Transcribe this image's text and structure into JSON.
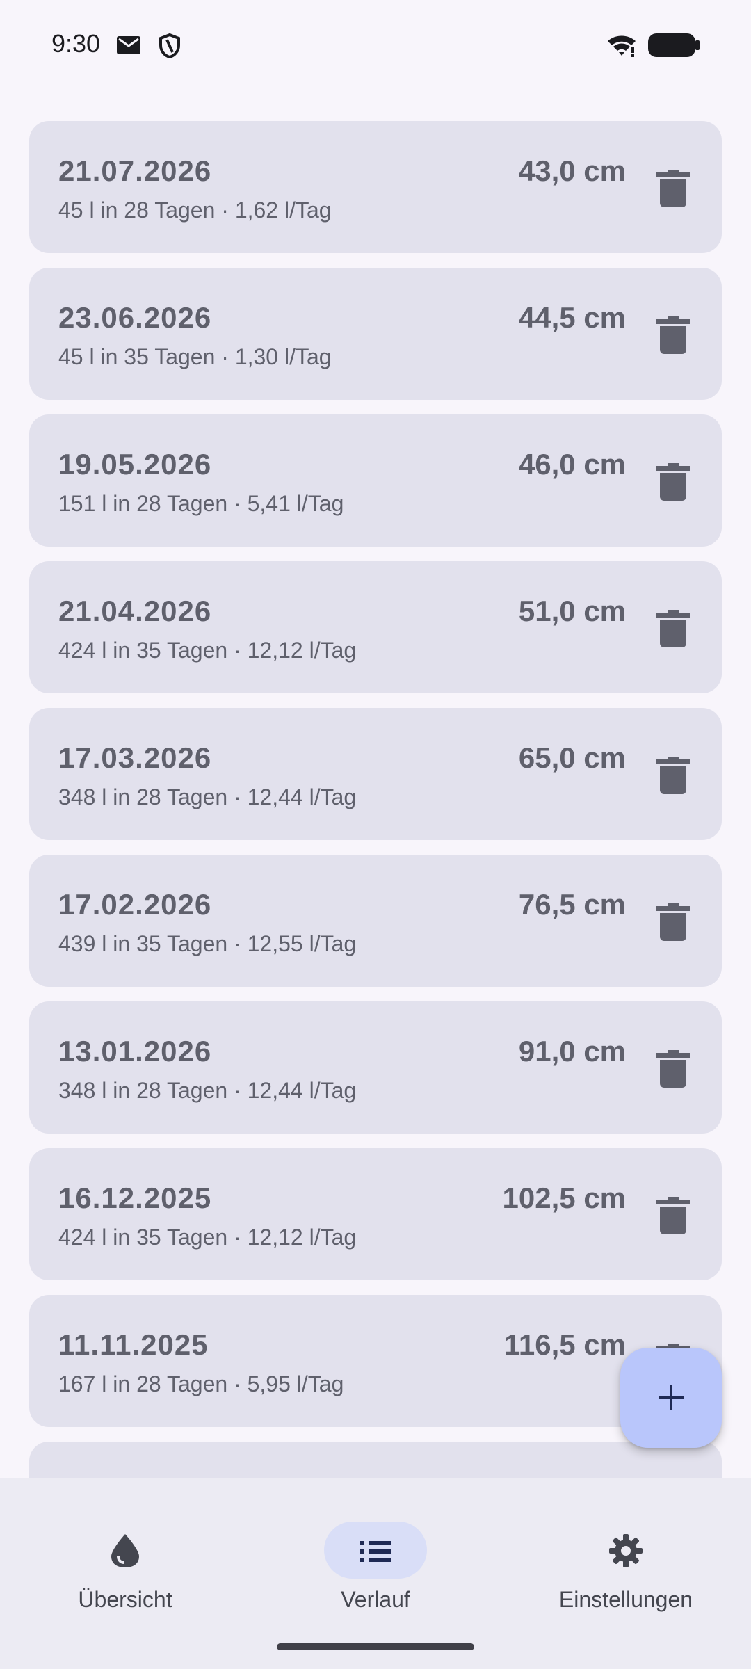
{
  "status_bar": {
    "time": "9:30"
  },
  "entries": [
    {
      "date": "21.07.2026",
      "level": "43,0 cm",
      "detail": "45 l in 28 Tagen · 1,62 l/Tag"
    },
    {
      "date": "23.06.2026",
      "level": "44,5 cm",
      "detail": "45 l in 35 Tagen · 1,30 l/Tag"
    },
    {
      "date": "19.05.2026",
      "level": "46,0 cm",
      "detail": "151 l in 28 Tagen · 5,41 l/Tag"
    },
    {
      "date": "21.04.2026",
      "level": "51,0 cm",
      "detail": "424 l in 35 Tagen · 12,12 l/Tag"
    },
    {
      "date": "17.03.2026",
      "level": "65,0 cm",
      "detail": "348 l in 28 Tagen · 12,44 l/Tag"
    },
    {
      "date": "17.02.2026",
      "level": "76,5 cm",
      "detail": "439 l in 35 Tagen · 12,55 l/Tag"
    },
    {
      "date": "13.01.2026",
      "level": "91,0 cm",
      "detail": "348 l in 28 Tagen · 12,44 l/Tag"
    },
    {
      "date": "16.12.2025",
      "level": "102,5 cm",
      "detail": "424 l in 35 Tagen · 12,12 l/Tag"
    },
    {
      "date": "11.11.2025",
      "level": "116,5 cm",
      "detail": "167 l in 28 Tagen · 5,95 l/Tag"
    }
  ],
  "fab": {
    "icon": "add-icon"
  },
  "bottom_nav": {
    "items": [
      {
        "label": "Übersicht",
        "icon": "water-drop-icon",
        "active": false
      },
      {
        "label": "Verlauf",
        "icon": "list-icon",
        "active": true
      },
      {
        "label": "Einstellungen",
        "icon": "gear-icon",
        "active": false
      }
    ]
  },
  "colors": {
    "background": "#f8f5fb",
    "card": "#e2e1ed",
    "text": "#5f606c",
    "fab": "#b9c6fb",
    "nav_background": "#ecebf3",
    "nav_active_pill": "#d9def7"
  }
}
